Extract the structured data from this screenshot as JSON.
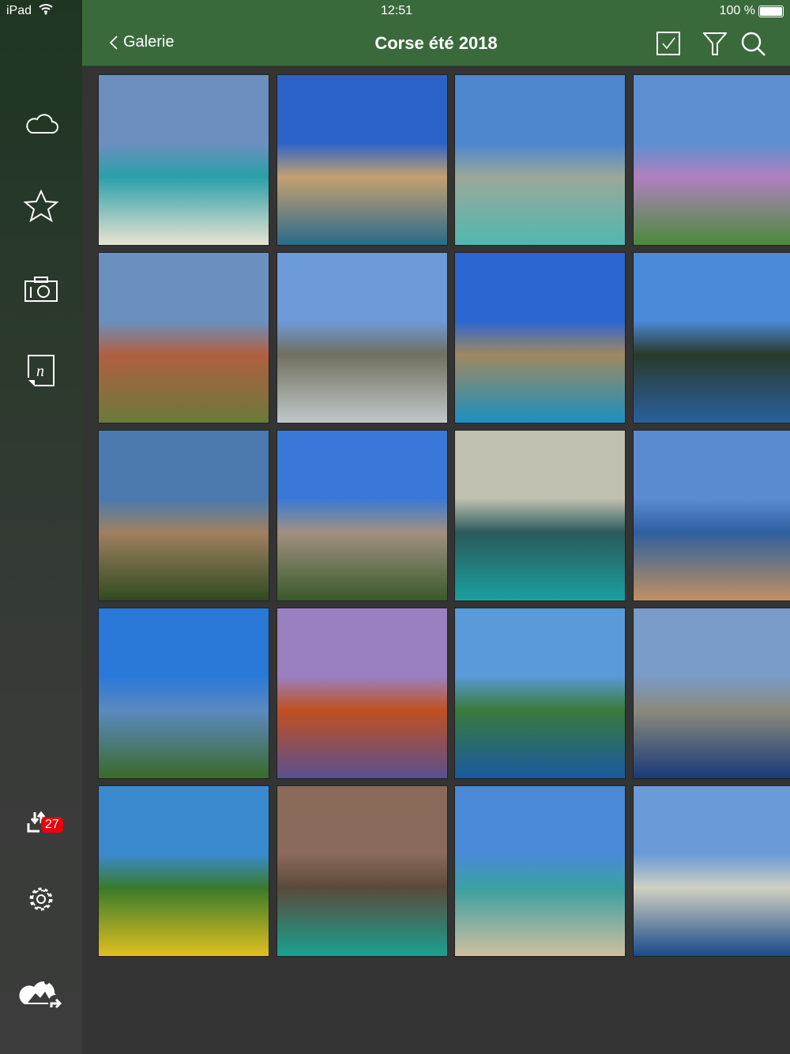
{
  "status_bar": {
    "device": "iPad",
    "time": "12:51",
    "battery": "100 %"
  },
  "header": {
    "back_label": "Galerie",
    "title": "Corse été 2018"
  },
  "sidebar": {
    "icons": [
      "cloud-icon",
      "star-icon",
      "camera-icon",
      "note-icon"
    ],
    "sync_badge": "27"
  },
  "colors": {
    "header": "#3a6a3c",
    "badge": "#e8000b"
  },
  "photos": [
    {
      "sky": "#6d8fc0",
      "sea": "#e9e3d3",
      "land": "#2aa0a8"
    },
    {
      "sky": "#2c63c8",
      "sea": "#2a6b8a",
      "land": "#c4a070"
    },
    {
      "sky": "#4b86cf",
      "sea": "#50b8b0",
      "land": "#9ba89a"
    },
    {
      "sky": "#5d8fd0",
      "sea": "#4a8a3a",
      "land": "#b080c0"
    },
    {
      "sky": "#6a90c0",
      "sea": "#6a7a3a",
      "land": "#b06040"
    },
    {
      "sky": "#6d9ad8",
      "sea": "#c0c8c8",
      "land": "#707060"
    },
    {
      "sky": "#2c66d0",
      "sea": "#1c90c0",
      "land": "#a08860"
    },
    {
      "sky": "#4a8ad8",
      "sea": "#2a60a0",
      "land": "#2a3a2a"
    },
    {
      "sky": "#4a7ab0",
      "sea": "#304a20",
      "land": "#a08060"
    },
    {
      "sky": "#3a78d8",
      "sea": "#3a5a2a",
      "land": "#a09080"
    },
    {
      "sky": "#c0c0b0",
      "sea": "#1aa0a0",
      "land": "#2a5a5a"
    },
    {
      "sky": "#5a8ad0",
      "sea": "#c09060",
      "land": "#3060a0"
    },
    {
      "sky": "#2a78d8",
      "sea": "#3a6a2a",
      "land": "#5a8ac0"
    },
    {
      "sky": "#9a80c0",
      "sea": "#5a5090",
      "land": "#c05020"
    },
    {
      "sky": "#5a9ad8",
      "sea": "#1a5aa0",
      "land": "#3a7a3a"
    },
    {
      "sky": "#7a9ac8",
      "sea": "#1a3a7a",
      "land": "#8a8a7a"
    },
    {
      "sky": "#3a8ad0",
      "sea": "#e0c020",
      "land": "#3a7a2a"
    },
    {
      "sky": "#8a6a5a",
      "sea": "#1aa090",
      "land": "#5a4a3a"
    },
    {
      "sky": "#4a8ad8",
      "sea": "#d0c0a0",
      "land": "#3aa0a0"
    },
    {
      "sky": "#6a9ad8",
      "sea": "#1a4a8a",
      "land": "#d0d0c0"
    }
  ]
}
